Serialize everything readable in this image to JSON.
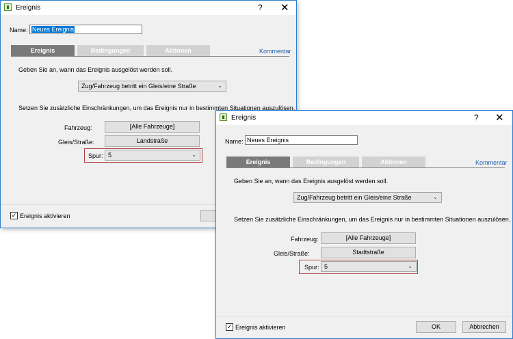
{
  "dialog": {
    "title": "Ereignis",
    "help": "?",
    "close": "✕",
    "name_label": "Name:",
    "tabs": [
      "Ereignis",
      "Bedingungen",
      "Aktionen"
    ],
    "kommentar": "Kommentar",
    "instruction1": "Geben Sie an, wann das Ereignis ausgelöst werden soll.",
    "trigger_value": "Zug/Fahrzeug betritt ein Gleis/eine Straße",
    "instruction2": "Setzen Sie zusätzliche Einschränkungen, um das Ereignis nur in bestimmten Situationen auszulösen.",
    "fahrzeug_label": "Fahrzeug:",
    "fahrzeug_value": "[Alle Fahrzeuge]",
    "gleis_label": "Gleis/Straße:",
    "spur_label": "Spur:",
    "spur_value": "5",
    "activate_label": "Ereignis aktivieren",
    "ok_label": "OK",
    "cancel_label": "Abbrechen",
    "chevron": "⌄",
    "check": "✓"
  },
  "back": {
    "name_value": "Neues Ereignis",
    "gleis_value": "Landstraße"
  },
  "front": {
    "name_value": "Neues Ereignis",
    "gleis_value": "Stadtstraße"
  }
}
